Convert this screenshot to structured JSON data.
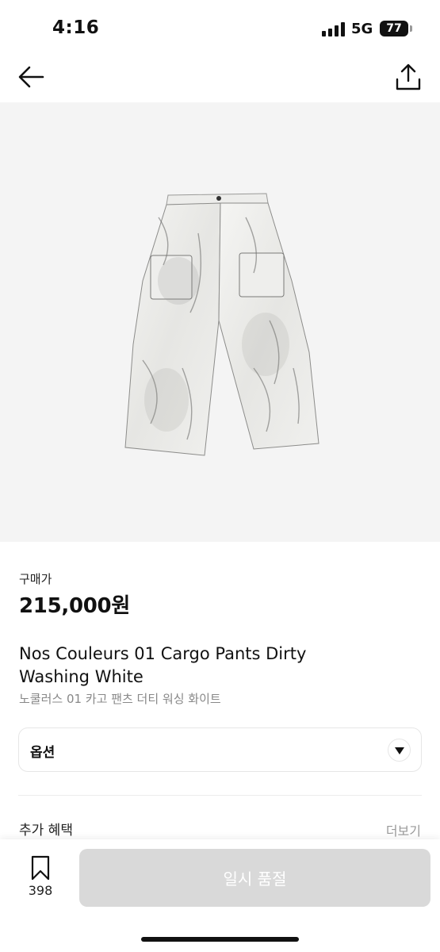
{
  "status_bar": {
    "time": "4:16",
    "network": "5G",
    "battery": "77"
  },
  "nav": {
    "back_icon": "arrow-left-icon",
    "share_icon": "share-icon"
  },
  "product": {
    "image_alt": "white cargo pants with dirty washing",
    "price_label": "구매가",
    "price": "215,000원",
    "name_en": "Nos Couleurs 01 Cargo Pants Dirty Washing White",
    "name_ko": "노쿨러스 01 카고 팬츠 더티 워싱 화이트"
  },
  "option": {
    "label": "옵션"
  },
  "benefits": {
    "label": "추가 혜택",
    "more": "더보기"
  },
  "bottom_bar": {
    "bookmark_count": "398",
    "action_label": "일시 품절"
  },
  "colors": {
    "image_bg": "#f4f4f4",
    "disabled_button": "#d9d9d9",
    "muted_text": "#888888"
  }
}
